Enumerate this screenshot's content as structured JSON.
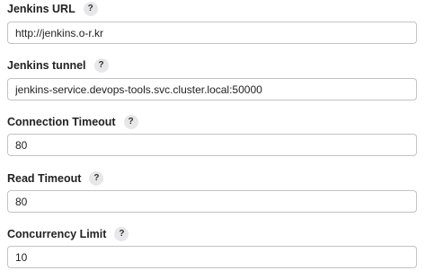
{
  "fields": [
    {
      "label": "Jenkins URL",
      "help": "?",
      "value": "http://jenkins.o-r.kr"
    },
    {
      "label": "Jenkins tunnel",
      "help": "?",
      "value": "jenkins-service.devops-tools.svc.cluster.local:50000"
    },
    {
      "label": "Connection Timeout",
      "help": "?",
      "value": "80"
    },
    {
      "label": "Read Timeout",
      "help": "?",
      "value": "80"
    },
    {
      "label": "Concurrency Limit",
      "help": "?",
      "value": "10"
    }
  ]
}
